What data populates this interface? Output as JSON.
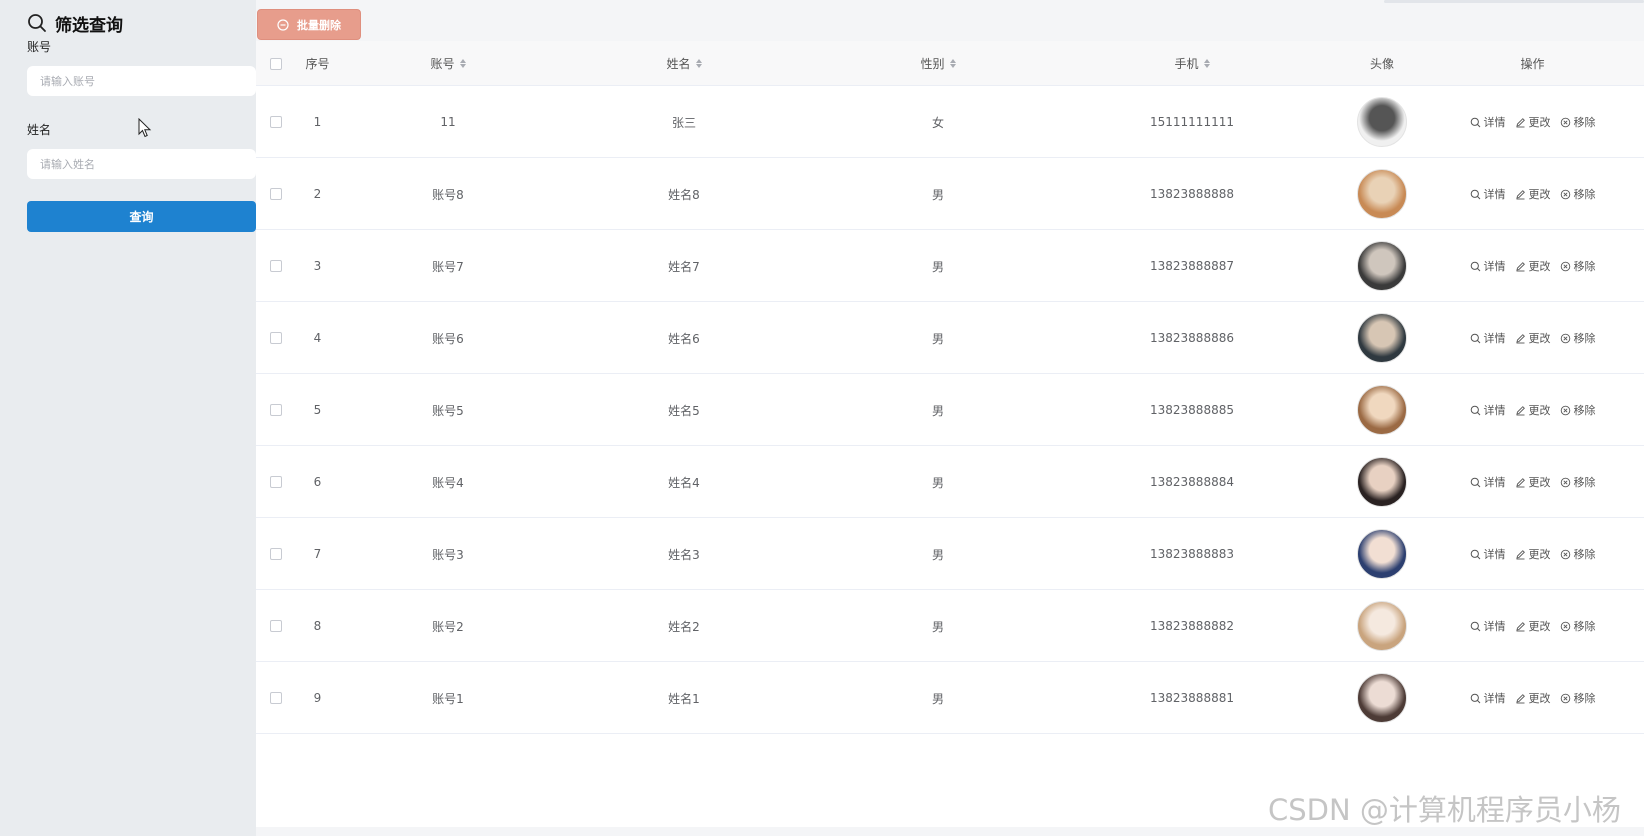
{
  "filter": {
    "title": "筛选查询",
    "account_label": "账号",
    "account_placeholder": "请输入账号",
    "account_value": "",
    "name_label": "姓名",
    "name_placeholder": "请输入姓名",
    "name_value": "",
    "query_label": "查询",
    "query_color": "#1e82d0"
  },
  "toolbar": {
    "batch_delete_label": "批量删除",
    "batch_delete_color": "#e79d8c"
  },
  "table": {
    "headers": {
      "index": "序号",
      "account": "账号",
      "name": "姓名",
      "gender": "性别",
      "phone": "手机",
      "avatar": "头像",
      "actions": "操作"
    },
    "action_labels": {
      "detail": "详情",
      "edit": "更改",
      "remove": "移除"
    },
    "rows": [
      {
        "index": "1",
        "account": "11",
        "name": "张三",
        "gender": "女",
        "phone": "15111111111",
        "avatar_colors": [
          "#f0f0f0",
          "#555555"
        ]
      },
      {
        "index": "2",
        "account": "账号8",
        "name": "姓名8",
        "gender": "男",
        "phone": "13823888888",
        "avatar_colors": [
          "#c88a55",
          "#e9d2b6"
        ]
      },
      {
        "index": "3",
        "account": "账号7",
        "name": "姓名7",
        "gender": "男",
        "phone": "13823888887",
        "avatar_colors": [
          "#3a3a3a",
          "#cfc6bd"
        ]
      },
      {
        "index": "4",
        "account": "账号6",
        "name": "姓名6",
        "gender": "男",
        "phone": "13823888886",
        "avatar_colors": [
          "#2f3940",
          "#d7c6b4"
        ]
      },
      {
        "index": "5",
        "account": "账号5",
        "name": "姓名5",
        "gender": "男",
        "phone": "13823888885",
        "avatar_colors": [
          "#9b6a44",
          "#f0d8bf"
        ]
      },
      {
        "index": "6",
        "account": "账号4",
        "name": "姓名4",
        "gender": "男",
        "phone": "13823888884",
        "avatar_colors": [
          "#2a2222",
          "#e8d1c2"
        ]
      },
      {
        "index": "7",
        "account": "账号3",
        "name": "姓名3",
        "gender": "男",
        "phone": "13823888883",
        "avatar_colors": [
          "#2c3f70",
          "#f2dfd3"
        ]
      },
      {
        "index": "8",
        "account": "账号2",
        "name": "姓名2",
        "gender": "男",
        "phone": "13823888882",
        "avatar_colors": [
          "#c9a47e",
          "#f5e9df"
        ]
      },
      {
        "index": "9",
        "account": "账号1",
        "name": "姓名1",
        "gender": "男",
        "phone": "13823888881",
        "avatar_colors": [
          "#4d3b36",
          "#ecdcd4"
        ]
      }
    ]
  },
  "watermark": "CSDN @计算机程序员小杨"
}
